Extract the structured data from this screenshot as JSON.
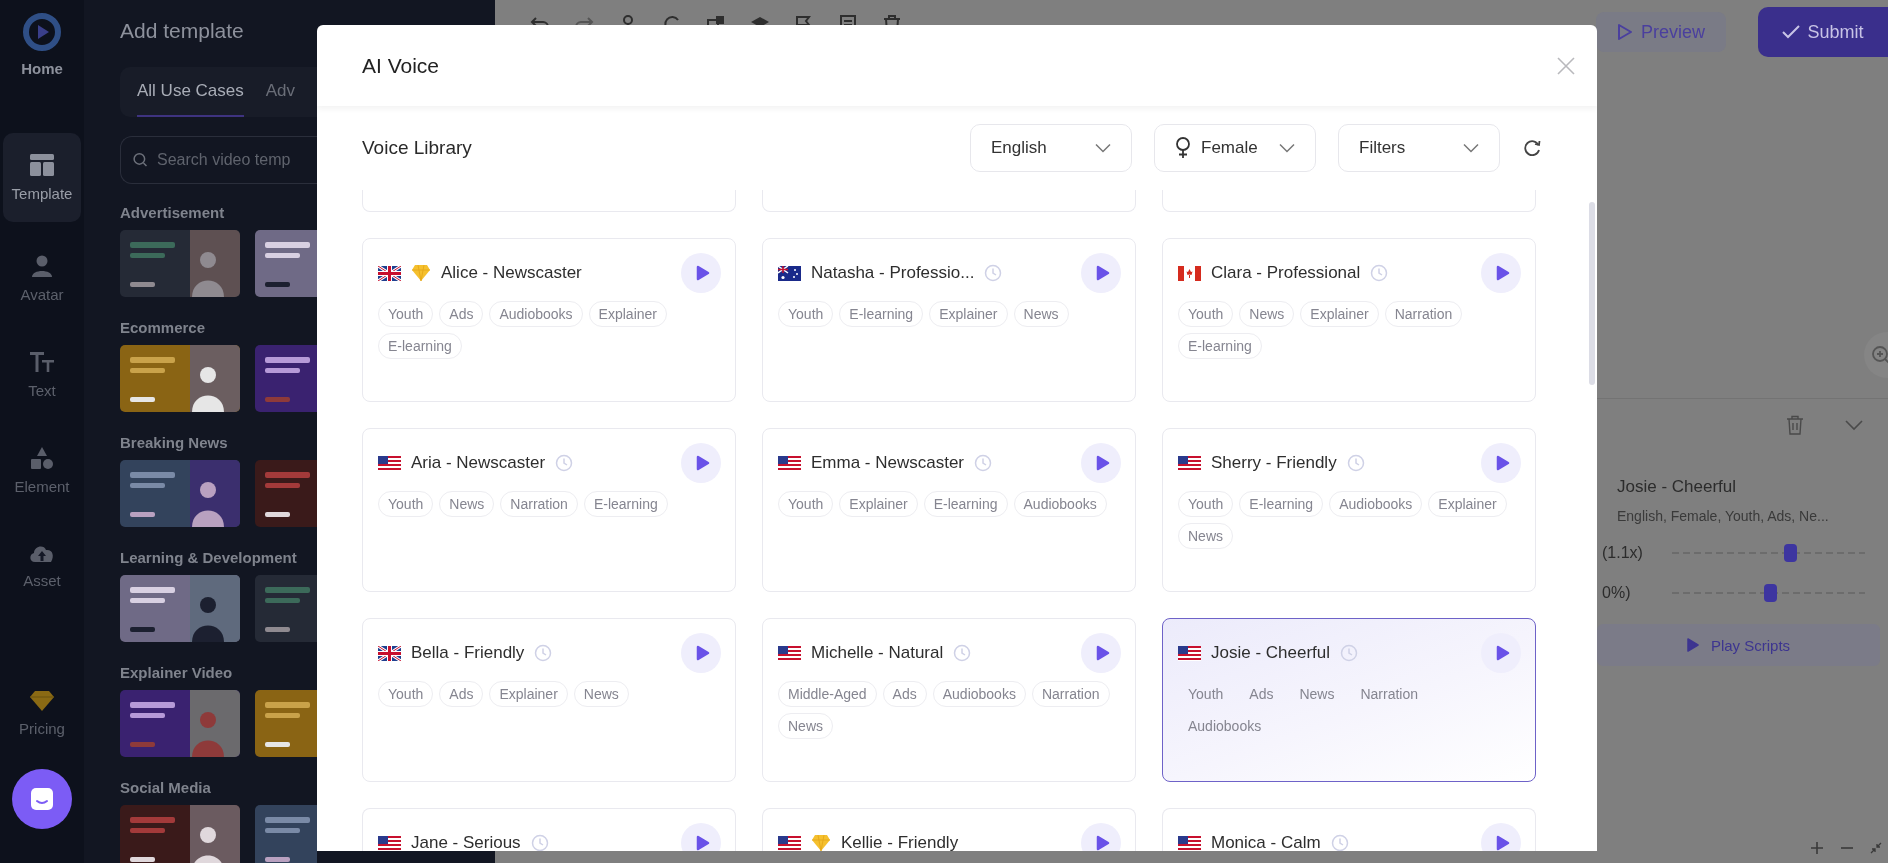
{
  "rail": {
    "items": [
      {
        "label": "Home",
        "kind": "logo",
        "selected": false
      },
      {
        "label": "Template",
        "kind": "template",
        "selected": true
      },
      {
        "label": "Avatar",
        "kind": "avatar",
        "selected": false
      },
      {
        "label": "Text",
        "kind": "text",
        "selected": false
      },
      {
        "label": "Element",
        "kind": "element",
        "selected": false
      },
      {
        "label": "Asset",
        "kind": "asset",
        "selected": false
      },
      {
        "label": "Pricing",
        "kind": "pricing",
        "selected": false
      }
    ]
  },
  "panel": {
    "title": "Add template",
    "tabs": [
      {
        "label": "All Use Cases",
        "selected": true
      },
      {
        "label": "Adv",
        "selected": false
      }
    ],
    "search": {
      "placeholder": "Search video temp"
    },
    "sections": [
      {
        "title": "Advertisement"
      },
      {
        "title": "Ecommerce"
      },
      {
        "title": "Breaking News"
      },
      {
        "title": "Learning & Development"
      },
      {
        "title": "Explainer Video"
      },
      {
        "title": "Social Media"
      }
    ]
  },
  "editor": {
    "preview_button": "Preview",
    "submit_button": "Submit"
  },
  "voice_panel": {
    "name": "Josie - Cheerful",
    "summary": "English, Female, Youth, Ads, Ne...",
    "speed": {
      "reading": "(1.1x)",
      "level": 0.61
    },
    "volume": {
      "reading": "0%)",
      "level": 0.51
    },
    "play_button": "Play Scripts"
  },
  "modal": {
    "title": "AI Voice",
    "library_title": "Voice Library",
    "filters": [
      {
        "label": "English",
        "kind": "plain"
      },
      {
        "label": "Female",
        "kind": "gender"
      },
      {
        "label": "Filters",
        "kind": "plain"
      }
    ],
    "voices": [
      {
        "kind": "top_cut"
      },
      {
        "kind": "top_cut"
      },
      {
        "kind": "top_cut"
      },
      {
        "kind": "full",
        "name": "Alice - Newscaster",
        "flag": {
          "kind": "gb"
        },
        "premium": true,
        "selected": false,
        "tags": [
          "Youth",
          "Ads",
          "Audiobooks",
          "Explainer",
          "E-learning"
        ]
      },
      {
        "kind": "full",
        "name": "Natasha - Professio...",
        "flag": {
          "kind": "au"
        },
        "premium": false,
        "selected": false,
        "tags": [
          "Youth",
          "E-learning",
          "Explainer",
          "News"
        ]
      },
      {
        "kind": "full",
        "name": "Clara - Professional",
        "flag": {
          "kind": "ca"
        },
        "premium": false,
        "selected": false,
        "tags": [
          "Youth",
          "News",
          "Explainer",
          "Narration",
          "E-learning"
        ]
      },
      {
        "kind": "full",
        "name": "Aria - Newscaster",
        "flag": {
          "kind": "us"
        },
        "premium": false,
        "selected": false,
        "tags": [
          "Youth",
          "News",
          "Narration",
          "E-learning"
        ]
      },
      {
        "kind": "full",
        "name": "Emma - Newscaster",
        "flag": {
          "kind": "us"
        },
        "premium": false,
        "selected": false,
        "tags": [
          "Youth",
          "Explainer",
          "E-learning",
          "Audiobooks"
        ]
      },
      {
        "kind": "full",
        "name": "Sherry - Friendly",
        "flag": {
          "kind": "us"
        },
        "premium": false,
        "selected": false,
        "tags": [
          "Youth",
          "E-learning",
          "Audiobooks",
          "Explainer",
          "News"
        ]
      },
      {
        "kind": "full",
        "name": "Bella - Friendly",
        "flag": {
          "kind": "gb"
        },
        "premium": false,
        "selected": false,
        "tags": [
          "Youth",
          "Ads",
          "Explainer",
          "News"
        ]
      },
      {
        "kind": "full",
        "name": "Michelle - Natural",
        "flag": {
          "kind": "us"
        },
        "premium": false,
        "selected": false,
        "tags": [
          "Middle-Aged",
          "Ads",
          "Audiobooks",
          "Narration",
          "News"
        ]
      },
      {
        "kind": "full",
        "name": "Josie - Cheerful",
        "flag": {
          "kind": "us"
        },
        "premium": false,
        "selected": true,
        "tags": [
          "Youth",
          "Ads",
          "News",
          "Narration",
          "Audiobooks"
        ]
      },
      {
        "kind": "bottom_cut",
        "name": "Jane - Serious",
        "flag": {
          "kind": "us"
        },
        "premium": false,
        "selected": false
      },
      {
        "kind": "bottom_cut",
        "name": "Kellie - Friendly",
        "flag": {
          "kind": "us"
        },
        "premium": true,
        "selected": false
      },
      {
        "kind": "bottom_cut",
        "name": "Monica - Calm",
        "flag": {
          "kind": "us"
        },
        "premium": false,
        "selected": false
      }
    ]
  }
}
